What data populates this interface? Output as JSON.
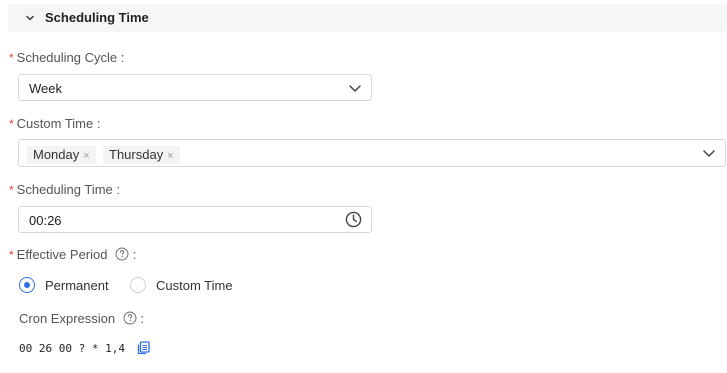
{
  "section": {
    "title": "Scheduling Time",
    "icon": "chevron-down-icon"
  },
  "fields": {
    "required_mark": "*",
    "scheduling_cycle": {
      "label": "Scheduling Cycle :",
      "value": "Week"
    },
    "custom_time": {
      "label": "Custom Time :",
      "tags": [
        "Monday",
        "Thursday"
      ],
      "tag_remove": "×"
    },
    "scheduling_time": {
      "label": "Scheduling Time :",
      "value": "00:26"
    },
    "effective_period": {
      "label": "Effective Period",
      "colon": ":",
      "options": [
        "Permanent",
        "Custom Time"
      ],
      "selected": "Permanent"
    },
    "cron_expression": {
      "label": "Cron Expression",
      "colon": ":",
      "value": "00 26 00 ? * 1,4"
    }
  },
  "colors": {
    "accent": "#2f6fe4",
    "required": "#e24a3b",
    "border": "#d9d9d9",
    "header_bg": "#f5f6f7"
  }
}
